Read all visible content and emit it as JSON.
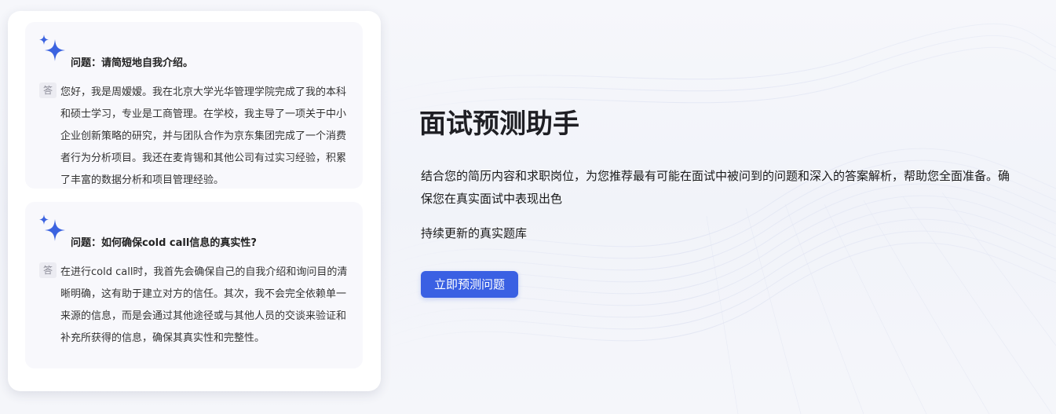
{
  "qa_cards": [
    {
      "question": "问题：请简短地自我介绍。",
      "answer_badge": "答",
      "answer": "您好，我是周嫒嫒。我在北京大学光华管理学院完成了我的本科和硕士学习，专业是工商管理。在学校，我主导了一项关于中小企业创新策略的研究，并与团队合作为京东集团完成了一个消费者行为分析项目。我还在麦肯锡和其他公司有过实习经验，积累了丰富的数据分析和项目管理经验。"
    },
    {
      "question": "问题：如何确保cold call信息的真实性?",
      "answer_badge": "答",
      "answer": "在进行cold call时，我首先会确保自己的自我介绍和询问目的清晰明确，这有助于建立对方的信任。其次，我不会完全依赖单一来源的信息，而是会通过其他途径或与其他人员的交谈来验证和补充所获得的信息，确保其真实性和完整性。"
    }
  ],
  "hero": {
    "title": "面试预测助手",
    "description": "结合您的简历内容和求职岗位，为您推荐最有可能在面试中被问到的问题和深入的答案解析，帮助您全面准备。确保您在真实面试中表现出色",
    "subtitle": "持续更新的真实题库",
    "cta_label": "立即预测问题"
  },
  "colors": {
    "accent": "#3a60e3",
    "sparkle": "#3b63e0",
    "card_bg": "#ffffff",
    "qa_bg": "#f8f8fc"
  },
  "icons": {
    "question_icon": "sparkle-icon"
  }
}
